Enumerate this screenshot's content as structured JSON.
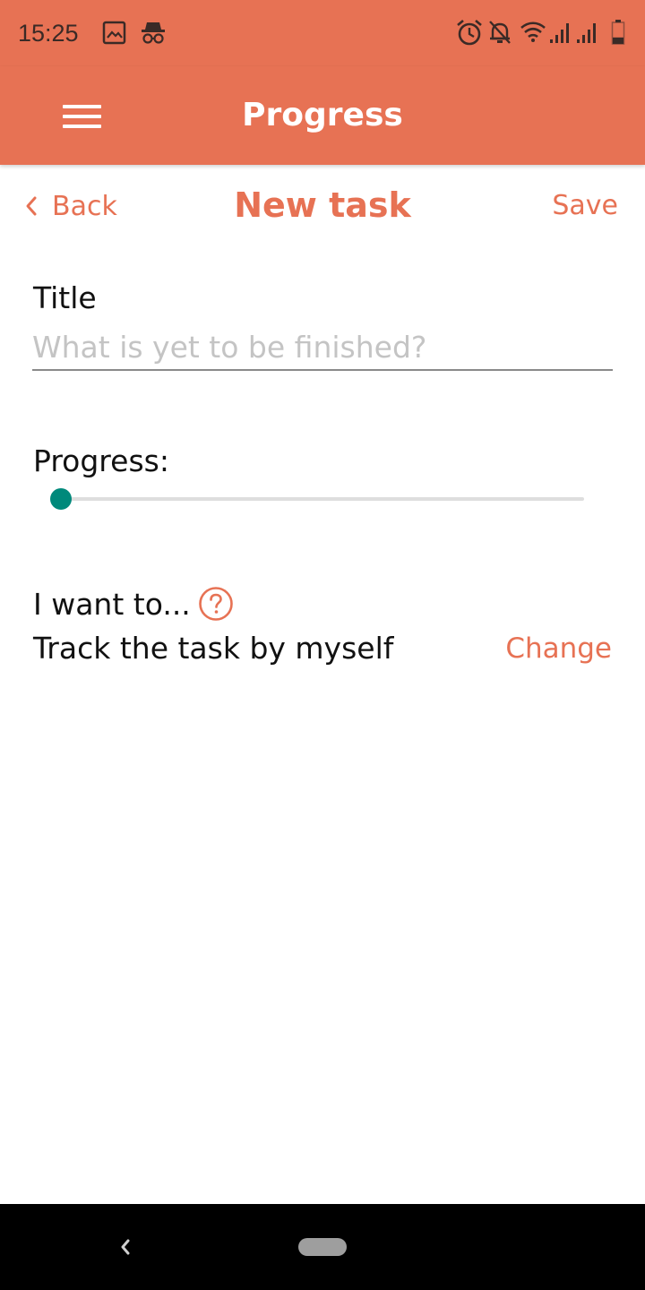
{
  "status_bar": {
    "time": "15:25",
    "left_icons": [
      "image-icon",
      "incognito-icon"
    ],
    "right_icons": [
      "alarm-icon",
      "bell-off-icon",
      "wifi-icon",
      "signal-icon",
      "signal-icon",
      "battery-icon"
    ],
    "battery_level": 0.3
  },
  "app_bar": {
    "title": "Progress",
    "menu_icon": "hamburger-menu-icon"
  },
  "nav": {
    "back_label": "Back",
    "title": "New task",
    "save_label": "Save"
  },
  "form": {
    "title_label": "Title",
    "title_value": "",
    "title_placeholder": "What is yet to be finished?",
    "progress_label": "Progress:",
    "progress_value": 0,
    "mode_label": "I want to...",
    "mode_value": "Track the task by myself",
    "change_label": "Change"
  },
  "colors": {
    "accent": "#e77254",
    "slider": "#00897b",
    "text": "#111111",
    "placeholder": "#c4c4c4"
  }
}
